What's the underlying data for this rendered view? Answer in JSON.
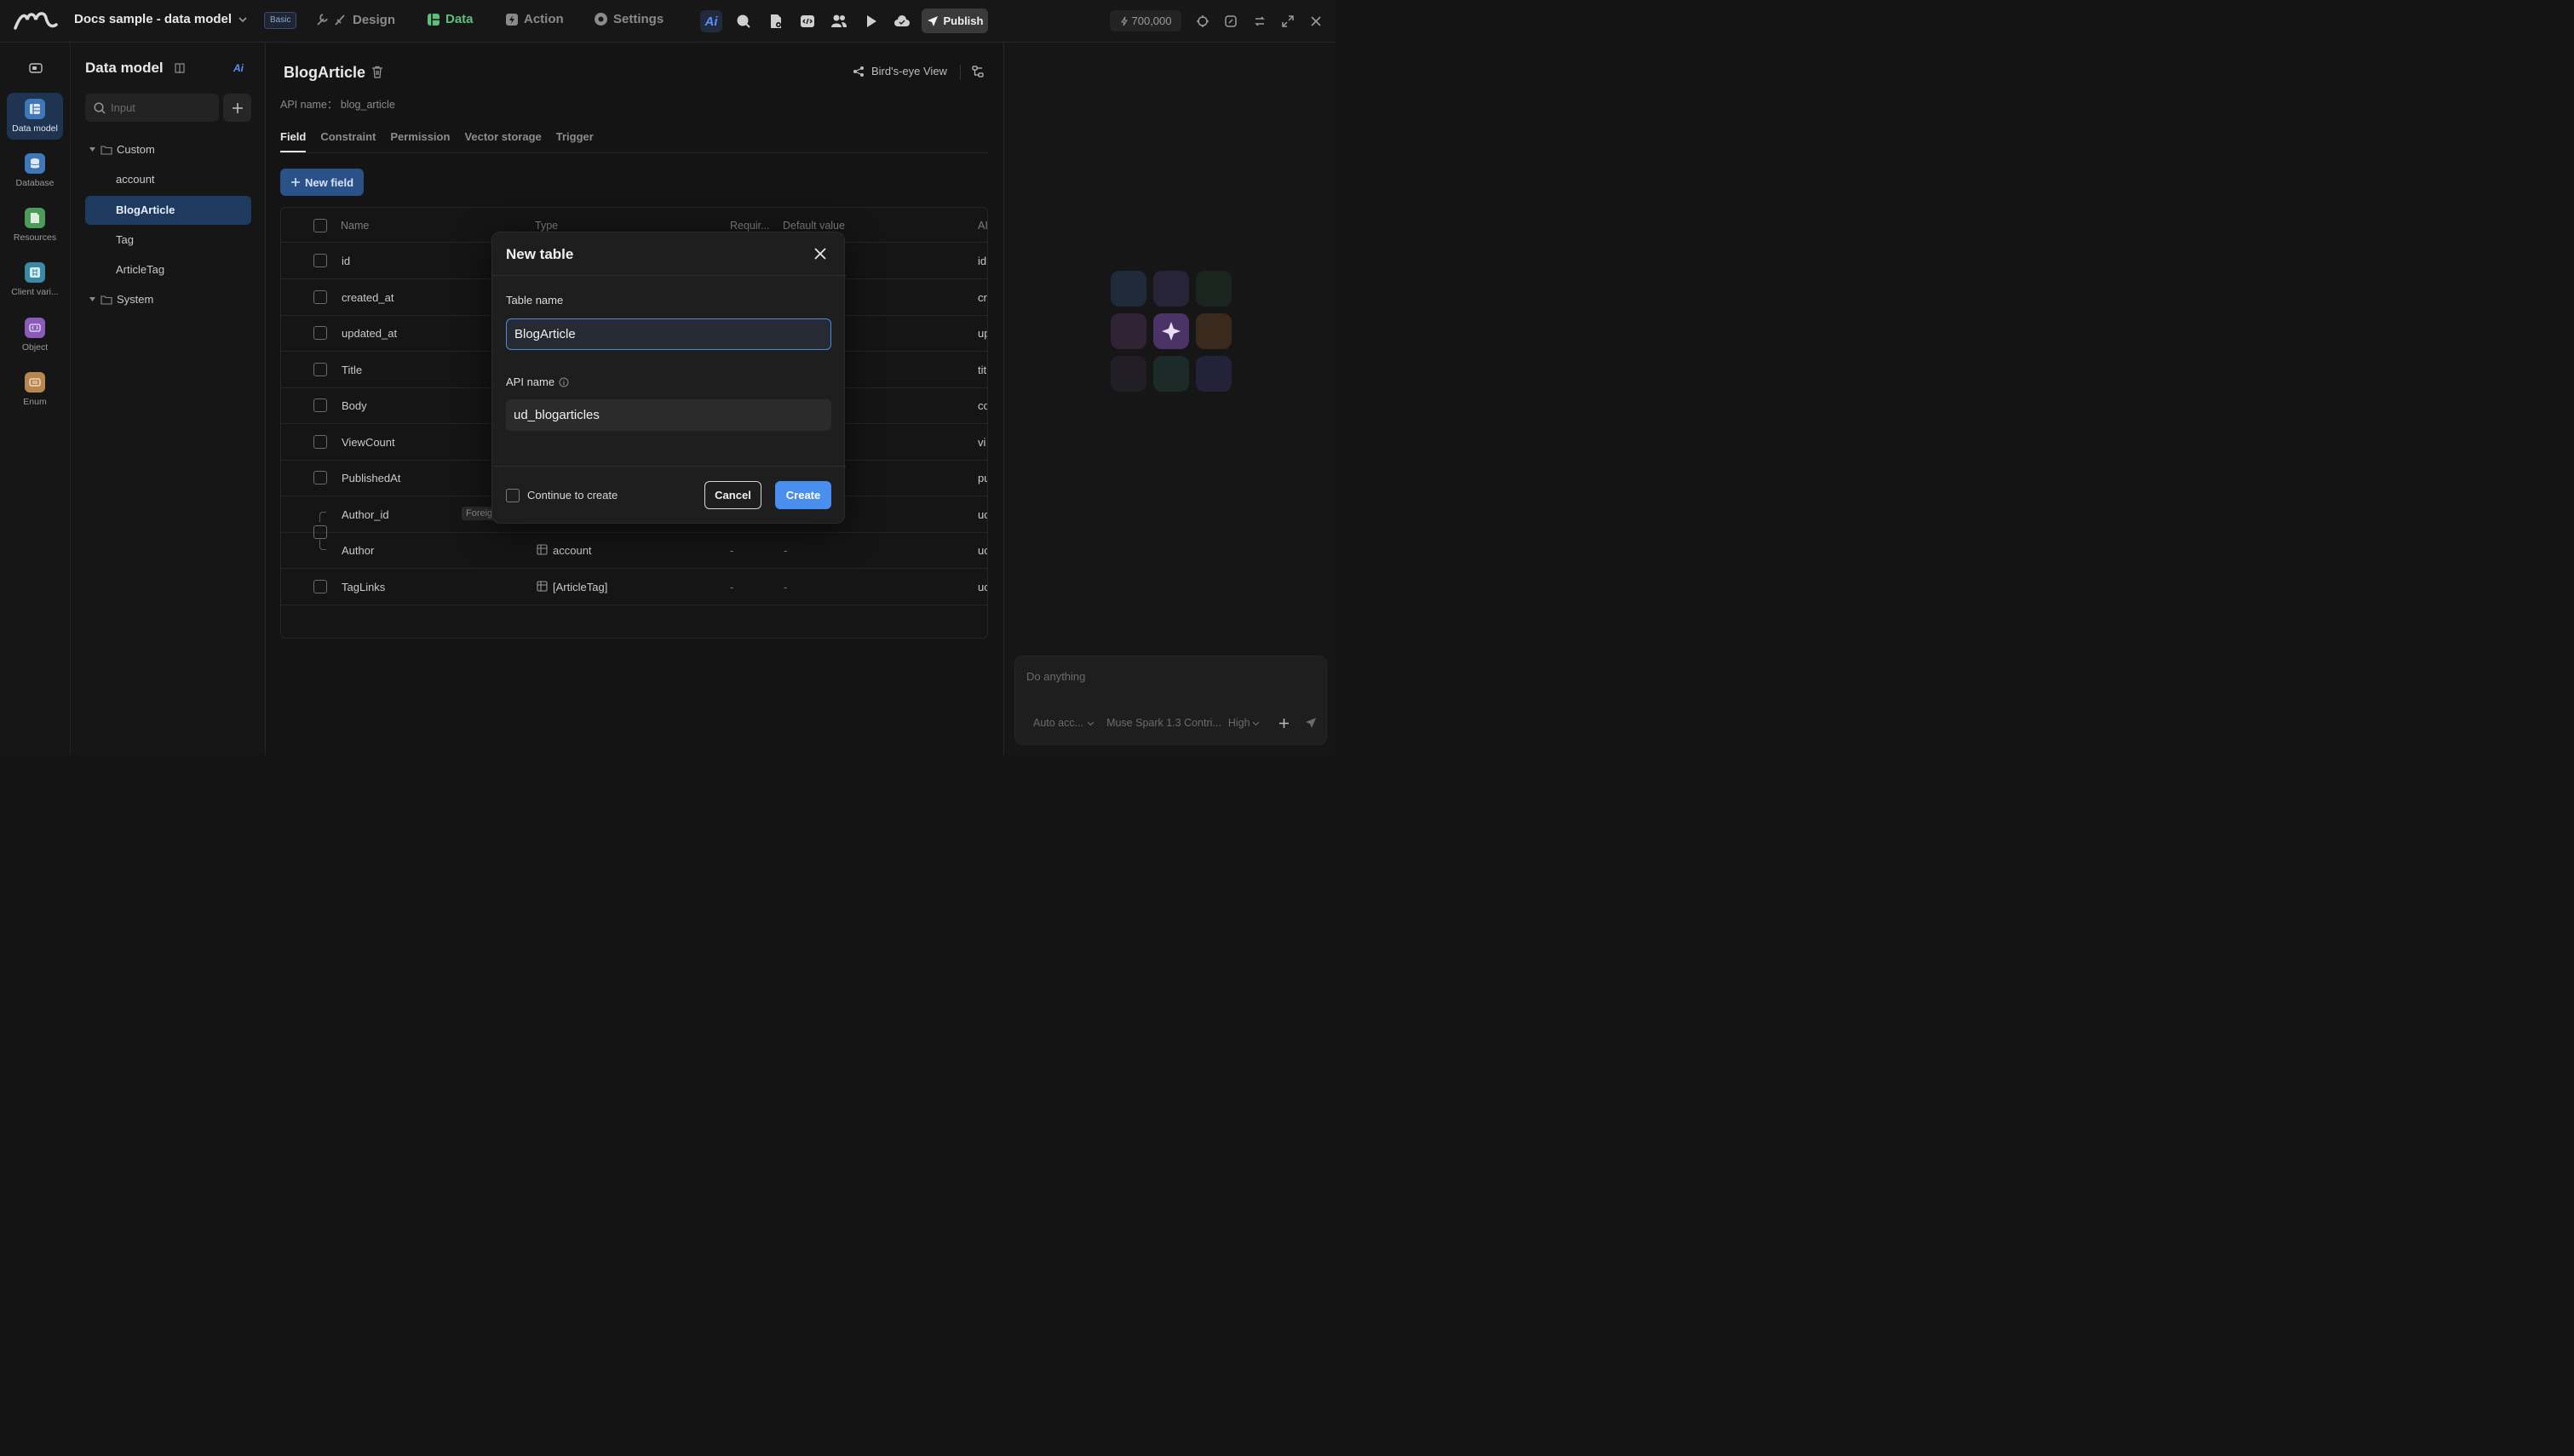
{
  "topbar": {
    "project_title": "Docs sample - data model",
    "plan_badge": "Basic",
    "tabs": [
      {
        "label": "Design",
        "icon": "wrench-brush-icon"
      },
      {
        "label": "Data",
        "icon": "data-grid-icon",
        "active": true
      },
      {
        "label": "Action",
        "icon": "lightning-icon"
      },
      {
        "label": "Settings",
        "icon": "gear-icon"
      }
    ],
    "publish_label": "Publish",
    "credits": "700,000"
  },
  "rail": {
    "items": [
      {
        "label": "Data model",
        "icon": "data-model-icon",
        "active": true
      },
      {
        "label": "Database",
        "icon": "database-icon"
      },
      {
        "label": "Resources",
        "icon": "resources-icon"
      },
      {
        "label": "Client vari...",
        "icon": "client-variable-icon"
      },
      {
        "label": "Object",
        "icon": "object-icon"
      },
      {
        "label": "Enum",
        "icon": "enum-icon"
      }
    ]
  },
  "data_model": {
    "title": "Data model",
    "ai_label": "Ai",
    "search_placeholder": "Input",
    "groups": [
      {
        "label": "Custom",
        "items": [
          "account",
          "BlogArticle",
          "Tag",
          "ArticleTag"
        ],
        "active": "BlogArticle"
      },
      {
        "label": "System",
        "items": []
      }
    ]
  },
  "main": {
    "table_title": "BlogArticle",
    "birdseye_label": "Bird's-eye View",
    "api_name_line": "API name： blog_article",
    "tabs": [
      "Field",
      "Constraint",
      "Permission",
      "Vector storage",
      "Trigger"
    ],
    "active_tab": "Field",
    "new_field_label": "New field",
    "columns": [
      "Name",
      "Type",
      "Requir...",
      "Default value",
      "AI"
    ],
    "rows": [
      {
        "name": "id",
        "type": "",
        "required": "",
        "default": "",
        "api": "id"
      },
      {
        "name": "created_at",
        "type": "",
        "required": "",
        "default": "",
        "api": "cr"
      },
      {
        "name": "updated_at",
        "type": "",
        "required": "",
        "default": "",
        "api": "up"
      },
      {
        "name": "Title",
        "type": "",
        "required": "",
        "default": "",
        "api": "tit"
      },
      {
        "name": "Body",
        "type": "",
        "required": "",
        "default": "",
        "api": "co"
      },
      {
        "name": "ViewCount",
        "type": "",
        "required": "",
        "default": "",
        "api": "vi"
      },
      {
        "name": "PublishedAt",
        "type": "",
        "required": "",
        "default": "",
        "api": "pu"
      },
      {
        "name": "Author_id",
        "tag": "Foreig",
        "type": "",
        "required": "",
        "default": "",
        "api": "uc"
      },
      {
        "name": "Author",
        "type": "account",
        "required": "-",
        "default": "-",
        "api": "uc"
      },
      {
        "name": "TagLinks",
        "type": "[ArticleTag]",
        "required": "-",
        "default": "-",
        "api": "uc"
      }
    ]
  },
  "chat": {
    "placeholder": "Do anything",
    "mode": "Auto acc...",
    "model": "Muse Spark 1.3 Contri...",
    "level": "High"
  },
  "modal": {
    "title": "New table",
    "table_name_label": "Table name",
    "table_name_value": "BlogArticle",
    "api_name_label": "API name",
    "api_name_value": "ud_blogarticles",
    "continue_label": "Continue to create",
    "cancel_label": "Cancel",
    "create_label": "Create"
  },
  "colors": {
    "accent_blue": "#4a8ff0",
    "data_green": "#5cc07c",
    "selected_bg": "#1f3a5f"
  }
}
